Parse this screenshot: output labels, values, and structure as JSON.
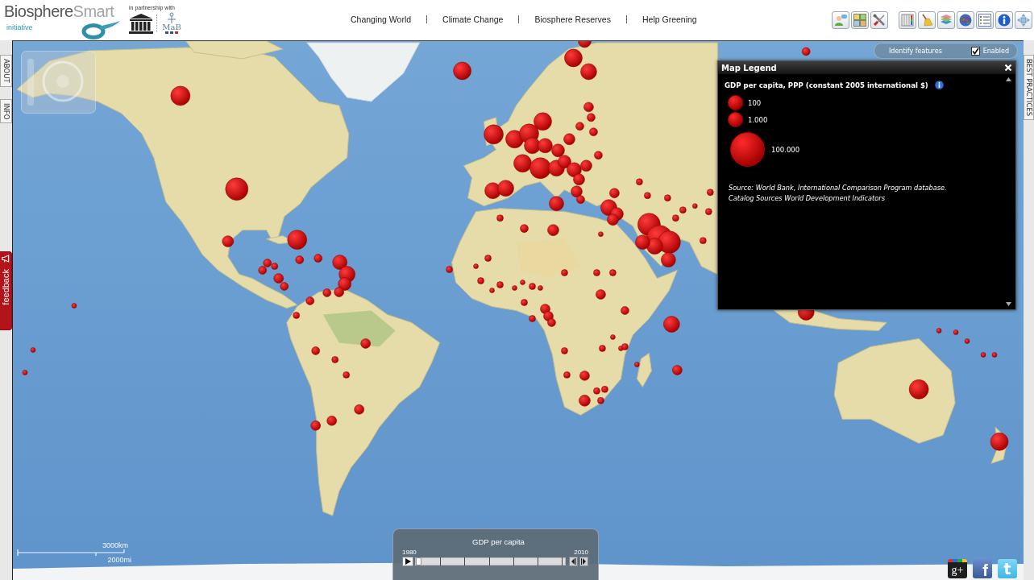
{
  "header": {
    "brand": {
      "name_start": "Biosphere",
      "name_end": "Smart",
      "tagline": "initiative"
    },
    "partnership": {
      "caption": "in partnership with",
      "mab_text": "MaB"
    },
    "nav": [
      "Changing World",
      "Climate Change",
      "Biosphere Reserves",
      "Help Greening"
    ]
  },
  "side_tabs": {
    "left": [
      "ABOUT",
      "INFO"
    ],
    "right": [
      "BEST PRACTICES"
    ]
  },
  "feedback": {
    "label": "feedback"
  },
  "identify": {
    "label": "Identify features",
    "option": {
      "label": "Enabled",
      "checked": true
    }
  },
  "legend": {
    "title": "Map Legend",
    "heading": "GDP per capita, PPP (constant 2005 international $)",
    "items": [
      {
        "label": "100",
        "kind": "small"
      },
      {
        "label": "1.000",
        "kind": "small"
      },
      {
        "label": "100.000",
        "kind": "large"
      }
    ],
    "source_lines": [
      "Source: World Bank, International Comparison Program database.",
      "Catalog Sources World Development Indicators"
    ]
  },
  "scale": {
    "metric": "3000km",
    "imperial": "2000mi"
  },
  "timeline": {
    "title": "GDP per capita",
    "start": "1980",
    "end": "2010",
    "level": 0
  },
  "social": [
    {
      "kind": "gplus",
      "label": "g+"
    },
    {
      "kind": "facebook",
      "label": "f"
    },
    {
      "kind": "twitter",
      "label": "t"
    }
  ]
}
